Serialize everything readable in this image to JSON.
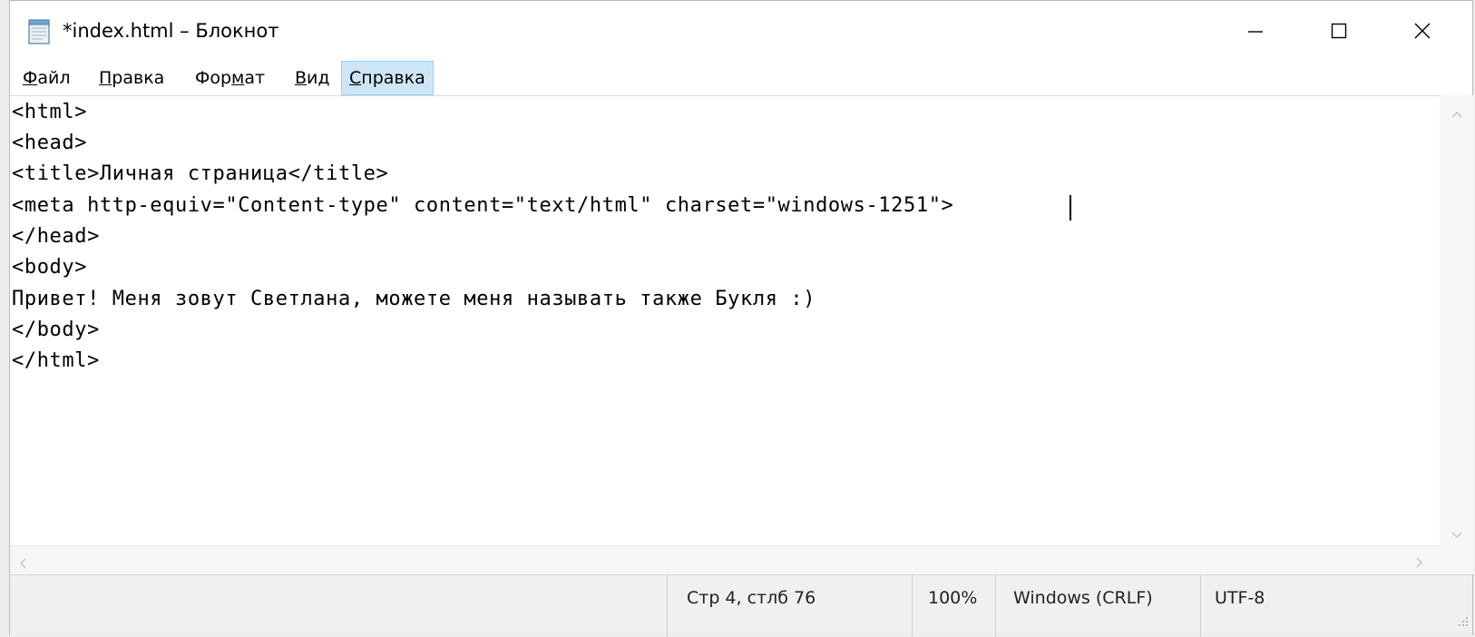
{
  "window": {
    "title": "*index.html – Блокнот"
  },
  "menu": {
    "items": [
      {
        "prefix": "",
        "underlined": "Ф",
        "rest": "айл"
      },
      {
        "prefix": "",
        "underlined": "П",
        "rest": "равка"
      },
      {
        "prefix": "Фор",
        "underlined": "м",
        "rest": "ат"
      },
      {
        "prefix": "",
        "underlined": "В",
        "rest": "ид"
      },
      {
        "prefix": "",
        "underlined": "С",
        "rest": "правка"
      }
    ]
  },
  "editor": {
    "lines": [
      "<html>",
      "<head>",
      "<title>Личная страница</title>",
      "<meta http-equiv=\"Content-type\" content=\"text/html\" charset=\"windows-1251\">",
      "</head>",
      "<body>",
      "Привет! Меня зовут Светлана, можете меня называть также Букля :)",
      "</body>",
      "</html>"
    ]
  },
  "status": {
    "position": "Стр 4, стлб 76",
    "zoom": "100%",
    "line_ending": "Windows (CRLF)",
    "encoding": "UTF-8"
  },
  "icons": {
    "app": "notepad-icon",
    "minimize": "minimize-icon",
    "maximize": "maximize-icon",
    "close": "close-icon",
    "scroll_up": "chevron-up-icon",
    "scroll_down": "chevron-down-icon",
    "scroll_left": "chevron-left-icon",
    "scroll_right": "chevron-right-icon",
    "grip": "resize-grip-icon"
  },
  "colors": {
    "menu_active_bg": "#cde6f7",
    "menu_active_border": "#99d1ff",
    "statusbar_bg": "#f0f0f0"
  }
}
